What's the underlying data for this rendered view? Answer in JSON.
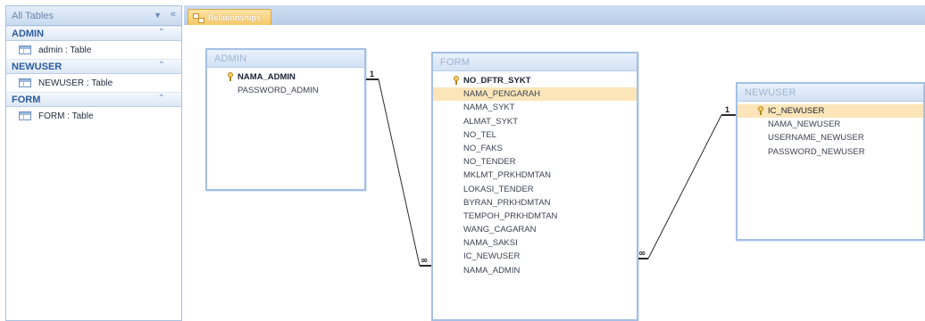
{
  "nav": {
    "title": "All Tables",
    "dropdown_icon": "chevron-down-icon",
    "collapse_icon": "double-chevron-left-icon",
    "groups": [
      {
        "label": "ADMIN",
        "items": [
          {
            "label": "admin : Table",
            "icon": "table-icon"
          }
        ]
      },
      {
        "label": "NEWUSER",
        "items": [
          {
            "label": "NEWUSER : Table",
            "icon": "table-icon"
          }
        ]
      },
      {
        "label": "FORM",
        "items": [
          {
            "label": "FORM : Table",
            "icon": "table-icon"
          }
        ]
      }
    ]
  },
  "tab": {
    "label": "Relationships",
    "icon": "relationships-icon"
  },
  "tables": {
    "admin": {
      "title": "ADMIN",
      "fields": [
        "NAMA_ADMIN",
        "PASSWORD_ADMIN"
      ]
    },
    "form": {
      "title": "FORM",
      "fields": [
        "NO_DFTR_SYKT",
        "NAMA_PENGARAH",
        "NAMA_SYKT",
        "ALMAT_SYKT",
        "NO_TEL",
        "NO_FAKS",
        "NO_TENDER",
        "MKLMT_PRKHDMTAN",
        "LOKASI_TENDER",
        "BYRAN_PRKHDMTAN",
        "TEMPOH_PRKHDMTAN",
        "WANG_CAGARAN",
        "NAMA_SAKSI",
        "IC_NEWUSER",
        "NAMA_ADMIN"
      ]
    },
    "newuser": {
      "title": "NEWUSER",
      "fields": [
        "IC_NEWUSER",
        "NAMA_NEWUSER",
        "USERNAME_NEWUSER",
        "PASSWORD_NEWUSER"
      ]
    }
  },
  "relationships": {
    "admin_form": {
      "one": "1",
      "many": "∞"
    },
    "newuser_form": {
      "one": "1",
      "many": "∞"
    }
  },
  "colors": {
    "accent": "#2d5c9e",
    "selection": "#fbe5b9",
    "tab": "#f5c868",
    "window_border": "#a4c0e6"
  }
}
